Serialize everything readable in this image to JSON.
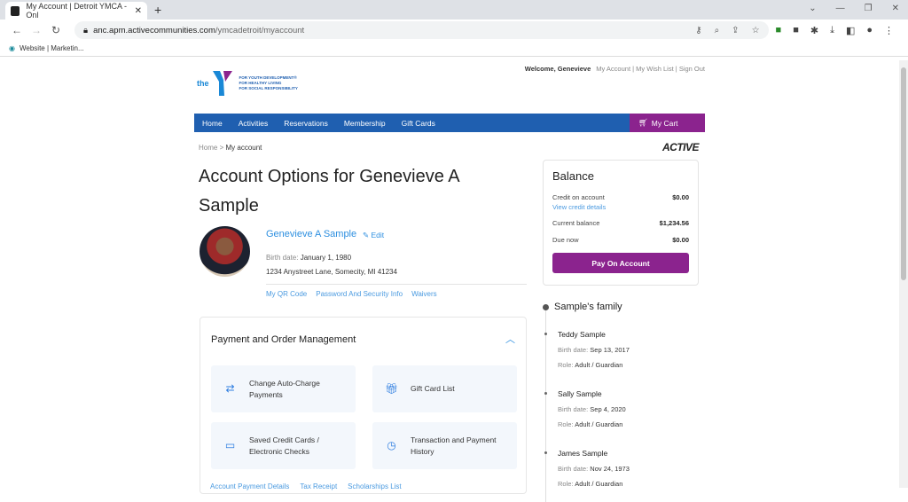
{
  "browser": {
    "tab_title": "My Account | Detroit YMCA - Onl",
    "url_host": "anc.apm.activecommunities.com",
    "url_path": "/ymcadetroit/myaccount",
    "bookmark": "Website | Marketin..."
  },
  "header": {
    "logo_text": "the",
    "tagline": [
      "FOR YOUTH DEVELOPMENT®",
      "FOR HEALTHY LIVING",
      "FOR SOCIAL RESPONSIBILITY"
    ],
    "welcome": "Welcome, Genevieve",
    "links": [
      "My Account",
      "My Wish List",
      "Sign Out"
    ]
  },
  "nav": {
    "items": [
      "Home",
      "Activities",
      "Reservations",
      "Membership",
      "Gift Cards"
    ],
    "cart": "My Cart"
  },
  "breadcrumb": {
    "home": "Home",
    "sep": ">",
    "current": "My account"
  },
  "brand": "ACTIVE",
  "page_title": "Account Options for Genevieve A Sample",
  "profile": {
    "name": "Genevieve A Sample",
    "edit": "Edit",
    "birth_label": "Birth date:",
    "birth": "January 1, 1980",
    "address": "1234 Anystreet Lane, Somecity, MI 41234",
    "links": [
      "My QR Code",
      "Password And Security Info",
      "Waivers"
    ]
  },
  "payment": {
    "title": "Payment and Order Management",
    "tiles": [
      {
        "label": "Change Auto-Charge Payments",
        "icon": "arrows-swap-icon"
      },
      {
        "label": "Gift Card List",
        "icon": "gift-card-icon"
      },
      {
        "label": "Saved Credit Cards / Electronic Checks",
        "icon": "credit-card-icon"
      },
      {
        "label": "Transaction and Payment History",
        "icon": "clock-icon"
      }
    ],
    "links": [
      "Account Payment Details",
      "Tax Receipt",
      "Scholarships List"
    ]
  },
  "balance": {
    "title": "Balance",
    "credit_label": "Credit on account",
    "credit": "$0.00",
    "view_credit": "View credit details",
    "current_label": "Current balance",
    "current": "$1,234.56",
    "due_label": "Due now",
    "due": "$0.00",
    "pay": "Pay On Account"
  },
  "family": {
    "title": "Sample's family",
    "members": [
      {
        "name": "Teddy Sample",
        "birth": "Sep 13, 2017",
        "role": "Adult / Guardian"
      },
      {
        "name": "Sally Sample",
        "birth": "Sep 4, 2020",
        "role": "Adult / Guardian"
      },
      {
        "name": "James Sample",
        "birth": "Nov 24, 1973",
        "role": "Adult / Guardian"
      }
    ],
    "birth_label": "Birth date:",
    "role_label": "Role:"
  },
  "colors": {
    "nav": "#1f5fb0",
    "accent": "#8b238e",
    "link": "#2d8fe0"
  }
}
